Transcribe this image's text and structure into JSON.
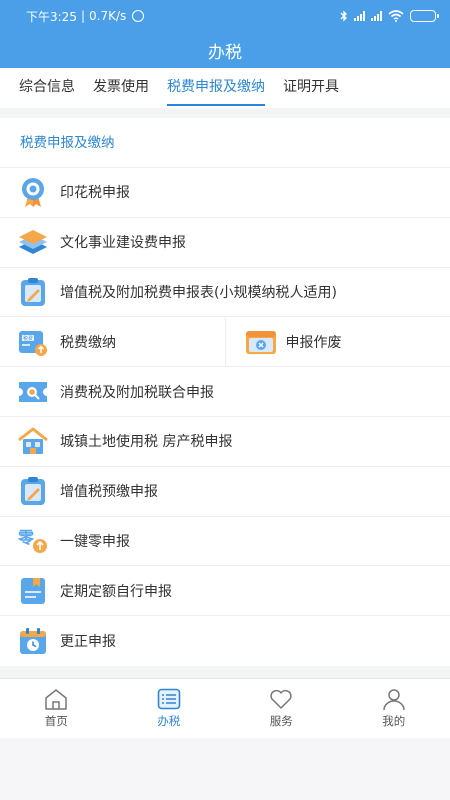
{
  "status_bar": {
    "time": "下午3:25",
    "speed": "0.7K/s"
  },
  "header": {
    "title": "办税"
  },
  "tabs": [
    {
      "label": "综合信息",
      "active": false
    },
    {
      "label": "发票使用",
      "active": false
    },
    {
      "label": "税费申报及缴纳",
      "active": true
    },
    {
      "label": "证明开具",
      "active": false
    }
  ],
  "section": {
    "title": "税费申报及缴纳"
  },
  "items": {
    "stamp_tax": {
      "label": "印花税申报",
      "icon": "stamp-medal-icon"
    },
    "culture_fee": {
      "label": "文化事业建设费申报",
      "icon": "layers-icon"
    },
    "vat_small": {
      "label": "增值税及附加税费申报表(小规模纳税人适用)",
      "icon": "clipboard-pen-icon"
    },
    "payment": {
      "label": "税费缴纳",
      "icon": "tax-payment-icon"
    },
    "void_declare": {
      "label": "申报作废",
      "icon": "void-window-icon"
    },
    "consumption_tax": {
      "label": "消费税及附加税联合申报",
      "icon": "ticket-search-icon"
    },
    "land_property": {
      "label": "城镇土地使用税 房产税申报",
      "icon": "house-icon"
    },
    "vat_prepay": {
      "label": "增值税预缴申报",
      "icon": "clipboard-pen-icon"
    },
    "zero_declare": {
      "label": "一键零申报",
      "icon": "zero-upload-icon"
    },
    "fixed_quota": {
      "label": "定期定额自行申报",
      "icon": "bookmark-doc-icon"
    },
    "correction": {
      "label": "更正申报",
      "icon": "calendar-clock-icon"
    }
  },
  "bottom_nav": [
    {
      "label": "首页",
      "icon": "home-icon",
      "active": false
    },
    {
      "label": "办税",
      "icon": "list-icon",
      "active": true
    },
    {
      "label": "服务",
      "icon": "heart-icon",
      "active": false
    },
    {
      "label": "我的",
      "icon": "user-icon",
      "active": false
    }
  ],
  "colors": {
    "primary": "#4a9fe8",
    "accent": "#2f86d2",
    "icon_orange": "#f5a84a",
    "icon_blue": "#5aa6ea"
  }
}
